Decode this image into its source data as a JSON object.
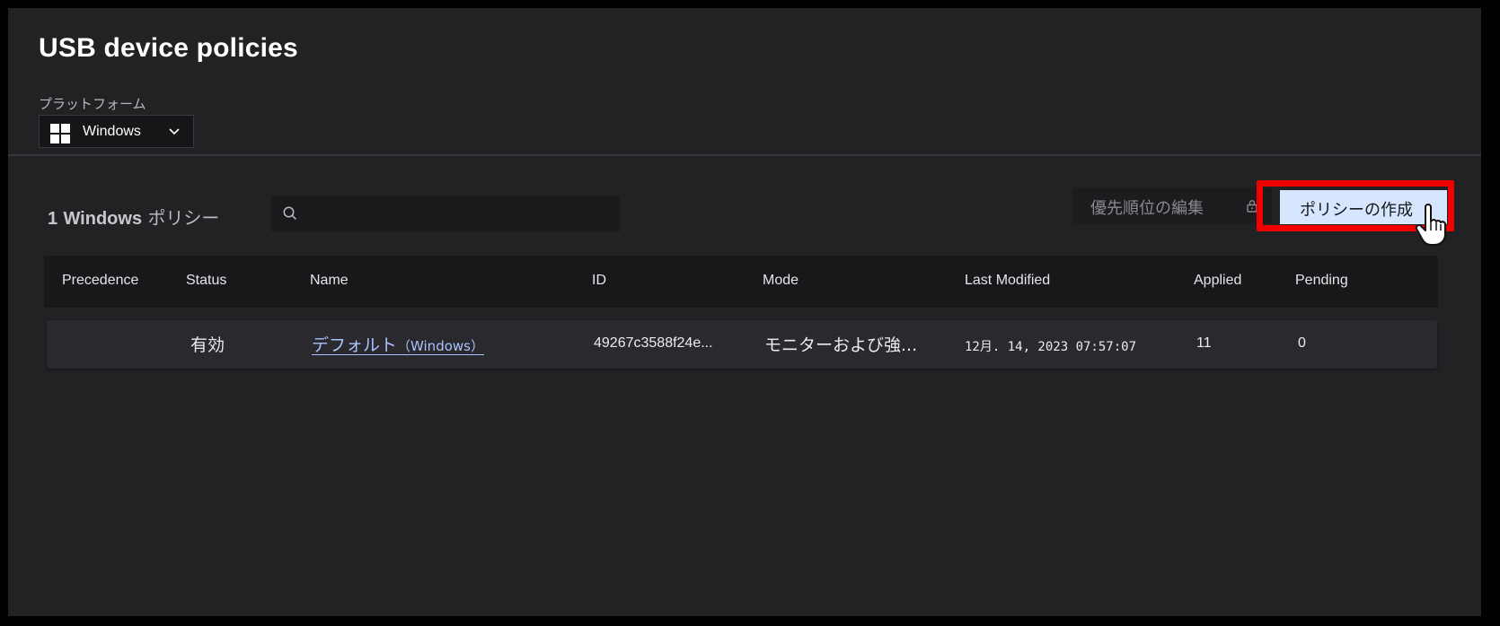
{
  "page": {
    "title": "USB device policies"
  },
  "platform": {
    "label": "プラットフォーム",
    "selected": "Windows",
    "icon": "windows-icon"
  },
  "toolbar": {
    "count_number": "1",
    "count_platform": "Windows",
    "count_suffix": "ポリシー",
    "search_placeholder": "",
    "search_value": "",
    "edit_priority_label": "優先順位の編集",
    "create_label": "ポリシーの作成"
  },
  "table": {
    "headers": [
      "Precedence",
      "Status",
      "Name",
      "ID",
      "Mode",
      "Last Modified",
      "Applied",
      "Pending"
    ],
    "rows": [
      {
        "precedence": "",
        "status": "有効",
        "name": "デフォルト",
        "name_suffix": "（Windows）",
        "id": "49267c3588f24e...",
        "mode": "モニターおよび強...",
        "last_modified": "12月. 14, 2023 07:57:07",
        "applied": "11",
        "pending": "0"
      }
    ]
  },
  "colors": {
    "background": "#222225",
    "header_row": "#18181b",
    "row": "#2a2a2e",
    "primary_button": "#d7e6ff",
    "link": "#a9c3ff",
    "highlight": "#f20000"
  }
}
